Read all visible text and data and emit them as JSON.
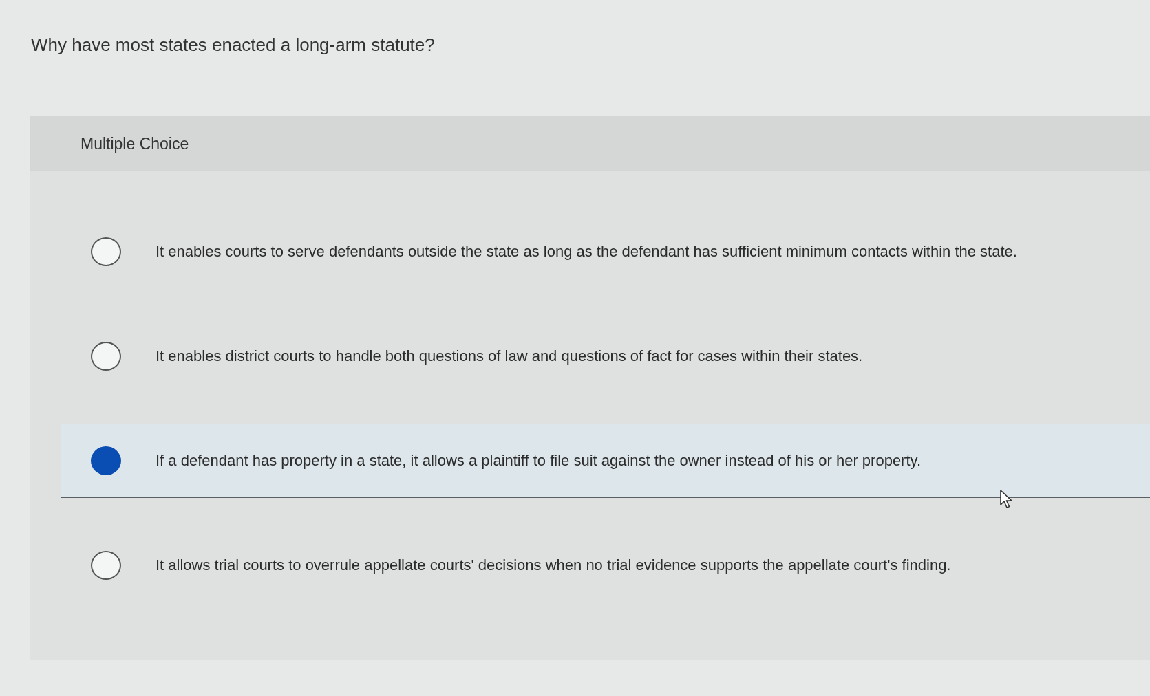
{
  "question": "Why have most states enacted a long-arm statute?",
  "panel": {
    "label": "Multiple Choice",
    "options": [
      {
        "text": "It enables courts to serve defendants outside the state as long as the defendant has sufficient minimum contacts within the state.",
        "selected": false
      },
      {
        "text": "It enables district courts to handle both questions of law and questions of fact for cases within their states.",
        "selected": false
      },
      {
        "text": "If a defendant has property in a state, it allows a plaintiff to file suit against the owner instead of his or her property.",
        "selected": true
      },
      {
        "text": "It allows trial courts to overrule appellate courts' decisions when no trial evidence supports the appellate court's finding.",
        "selected": false
      }
    ]
  }
}
